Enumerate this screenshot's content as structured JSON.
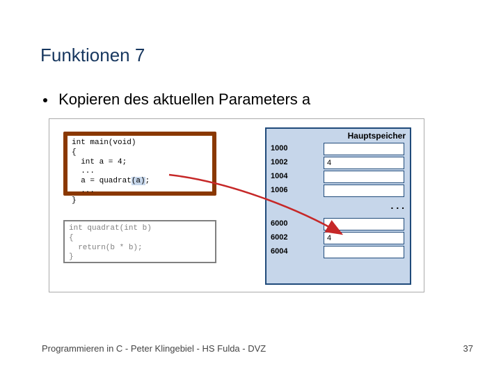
{
  "title": "Funktionen 7",
  "bullet": "Kopieren des aktuellen Parameters a",
  "code_main": "int main(void)\n{\n  int a = 4;\n  ...\n  a = quadrat(a);\n  ...\n}",
  "code_highlight_text": "(a)",
  "code_func": "int quadrat(int b)\n{\n  return(b * b);\n}",
  "memory": {
    "header": "Hauptspeicher",
    "block1": [
      {
        "addr": "1000",
        "val": ""
      },
      {
        "addr": "1002",
        "val": "4"
      },
      {
        "addr": "1004",
        "val": ""
      },
      {
        "addr": "1006",
        "val": ""
      }
    ],
    "ellipsis": ". . .",
    "block2": [
      {
        "addr": "6000",
        "val": ""
      },
      {
        "addr": "6002",
        "val": "4"
      },
      {
        "addr": "6004",
        "val": ""
      }
    ]
  },
  "footer": "Programmieren in C - Peter Klingebiel - HS Fulda - DVZ",
  "page": "37"
}
